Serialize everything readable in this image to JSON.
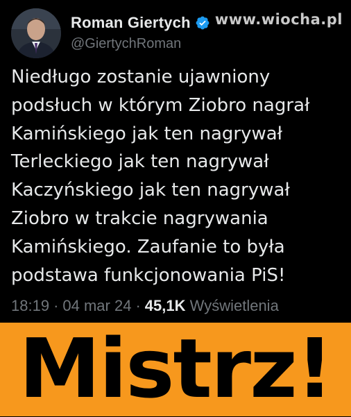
{
  "tweet": {
    "author": {
      "display_name": "Roman Giertych",
      "handle": "@GiertychRoman",
      "verified": true,
      "verified_icon": "verified-badge-icon"
    },
    "text": "Niedługo zostanie ujawniony\npodsłuch w którym Ziobro nagrał\nKamińskiego jak ten nagrywał\nTerleckiego jak ten nagrywał\nKaczyńskiego jak ten nagrywał\nZiobro w trakcie nagrywania\nKamińskiego. Zaufanie to była\npodstawa funkcjonowania PiS!",
    "time": "18:19",
    "date": "04 mar 24",
    "separator": "·",
    "views_count": "45,1K",
    "views_label": "Wyświetlenia"
  },
  "watermark": "www.wiocha.pl",
  "banner": {
    "text": "Mistrz!",
    "background": "#f7981d",
    "color": "#000000"
  },
  "colors": {
    "background": "#000000",
    "primary_text": "#e7e9ea",
    "secondary_text": "#71767b",
    "verified": "#1d9bf0"
  }
}
